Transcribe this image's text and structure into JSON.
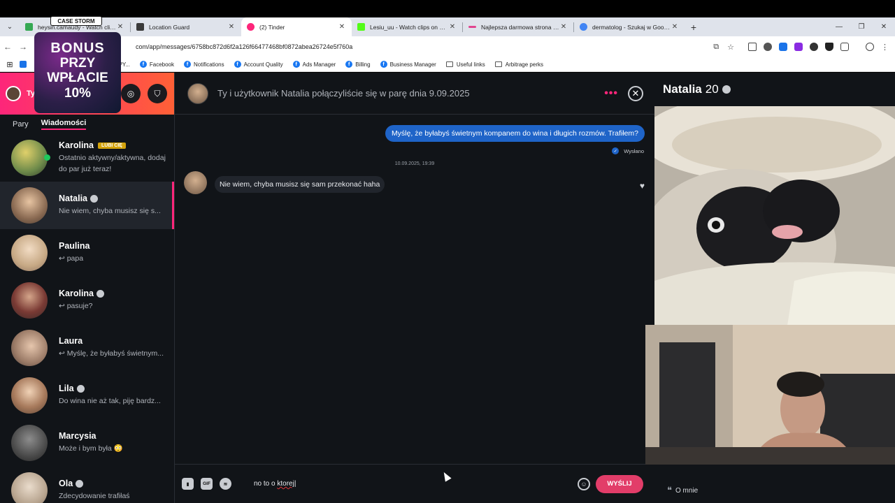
{
  "browser": {
    "tabs": [
      {
        "title": "heysin.camaudy - Watch clips",
        "color": "#35a853"
      },
      {
        "title": "Location Guard",
        "color": "#3a3a3a"
      },
      {
        "title": "(2) Tinder",
        "color": "#fd267a"
      },
      {
        "title": "Lesiu_uu - Watch clips on Kick",
        "color": "#53fc18"
      },
      {
        "title": "Najlepsza darmowa strona i ap...",
        "color": "#e0458f"
      },
      {
        "title": "dermatolog - Szukaj w Google",
        "color": "#4285f4"
      }
    ],
    "url": "com/app/messages/6758bc872d6f2a126f66477468bf0872abea26724e5f760a",
    "bookmarks": [
      {
        "label": "uxil SPY...",
        "icon": "folder-icon"
      },
      {
        "label": "Facebook",
        "icon": "facebook-icon"
      },
      {
        "label": "Notifications",
        "icon": "facebook-icon"
      },
      {
        "label": "Account Quality",
        "icon": "facebook-icon"
      },
      {
        "label": "Ads Manager",
        "icon": "facebook-icon"
      },
      {
        "label": "Billing",
        "icon": "facebook-icon"
      },
      {
        "label": "Business Manager",
        "icon": "facebook-icon"
      },
      {
        "label": "Useful links",
        "icon": "folder-icon"
      },
      {
        "label": "Arbitrage perks",
        "icon": "folder-icon"
      }
    ]
  },
  "overlay": {
    "logo": "CASE STORM",
    "promo_line1": "BONUS",
    "promo_line2": "PRZY",
    "promo_line3": "WPŁACIE",
    "promo_line4": "10%"
  },
  "sidebar": {
    "me_label": "Ty",
    "tabs": {
      "matches": "Pary",
      "messages": "Wiadomości"
    },
    "conversations": [
      {
        "name": "Karolina",
        "badge": "LUBI CIĘ",
        "preview": "Ostatnio aktywny/aktywna, dodaj do par już teraz!",
        "online": true,
        "verified": false
      },
      {
        "name": "Natalia",
        "badge": "",
        "preview": "Nie wiem, chyba musisz się s...",
        "online": false,
        "verified": true,
        "selected": true
      },
      {
        "name": "Paulina",
        "badge": "",
        "preview": "↩ papa",
        "online": false,
        "verified": false
      },
      {
        "name": "Karolina",
        "badge": "",
        "preview": "↩ pasuje?",
        "online": false,
        "verified": true
      },
      {
        "name": "Laura",
        "badge": "",
        "preview": "↩ Myślę, że byłabyś świetnym...",
        "online": false,
        "verified": false
      },
      {
        "name": "Lila",
        "badge": "",
        "preview": "Do wina nie aż tak, piję bardz...",
        "online": false,
        "verified": true
      },
      {
        "name": "Marcysia",
        "badge": "",
        "preview": "Może i bym była 😳",
        "online": false,
        "verified": false
      },
      {
        "name": "Ola",
        "badge": "",
        "preview": "Zdecydowanie trafiłaś",
        "online": false,
        "verified": true
      }
    ]
  },
  "chat": {
    "header_title": "Ty i użytkownik Natalia połączyliście się w parę dnia 9.09.2025",
    "outgoing": "Myślę, że byłabyś świetnym kompanem do wina i długich rozmów. Trafiłem?",
    "sent_status": "Wysłano",
    "timestamp": "10.09.2025, 19:39",
    "incoming": "Nie wiem, chyba musisz się sam przekonać haha",
    "composer_text_ok": "no to o ",
    "composer_text_err": "ktorej",
    "gif_label": "GIF",
    "send_label": "WYŚLIJ"
  },
  "profile": {
    "name": "Natalia",
    "age": "20",
    "about_label": "O mnie"
  }
}
